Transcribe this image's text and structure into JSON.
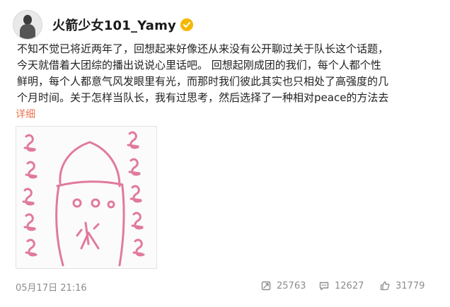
{
  "post": {
    "username": "火箭少女101_Yamy",
    "body_lines": [
      "不知不觉已将近两年了，回想起来好像还从来没有公开聊过关于队长这个话题，",
      "今天就借着大团综的播出说说心里话吧。    回想起刚成团的我们，每个人都个性",
      "鲜明，每个人都意气风发眼里有光，而那时我们彼此其实也只相处了高强度的几",
      "个月时间。关于怎样当队长，我有过思考，然后选择了一种相对peace的方法去"
    ],
    "more_link": "详细",
    "timestamp": "05月17日 21:16"
  },
  "image": {
    "drawing_character": "火",
    "ink_color": "#e07a9c"
  },
  "actions": {
    "repost_count": "25763",
    "comment_count": "12627",
    "like_count": "31779"
  },
  "colors": {
    "link": "#eb7350",
    "verified_badge": "#f5b800",
    "meta_text": "#8c8c8c"
  },
  "icons": [
    "avatar",
    "verified-icon",
    "repost-icon",
    "comment-icon",
    "like-icon"
  ]
}
